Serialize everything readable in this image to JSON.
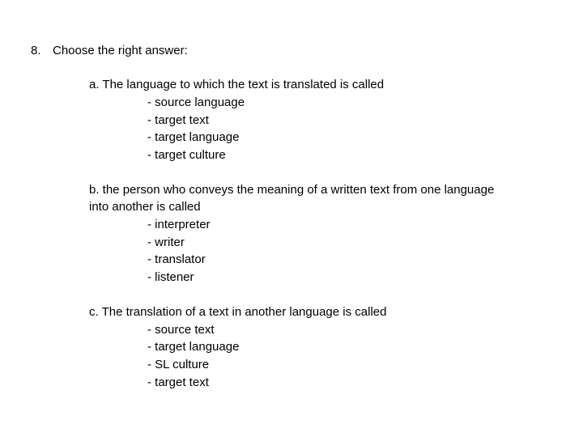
{
  "heading": {
    "number": "8.",
    "text": "Choose the right answer:"
  },
  "questions": [
    {
      "prompt": "a. The language to which the text is translated is called",
      "options": [
        "- source language",
        "- target text",
        "- target language",
        "- target culture"
      ]
    },
    {
      "prompt_line1": "b. the person who conveys the meaning of a written text from one language",
      "prompt_line2": "into another is called",
      "options": [
        "- interpreter",
        "- writer",
        "- translator",
        "- listener"
      ]
    },
    {
      "prompt": "c. The translation of a text in another language is called",
      "options": [
        "- source text",
        "- target language",
        "- SL culture",
        "- target text"
      ]
    }
  ]
}
